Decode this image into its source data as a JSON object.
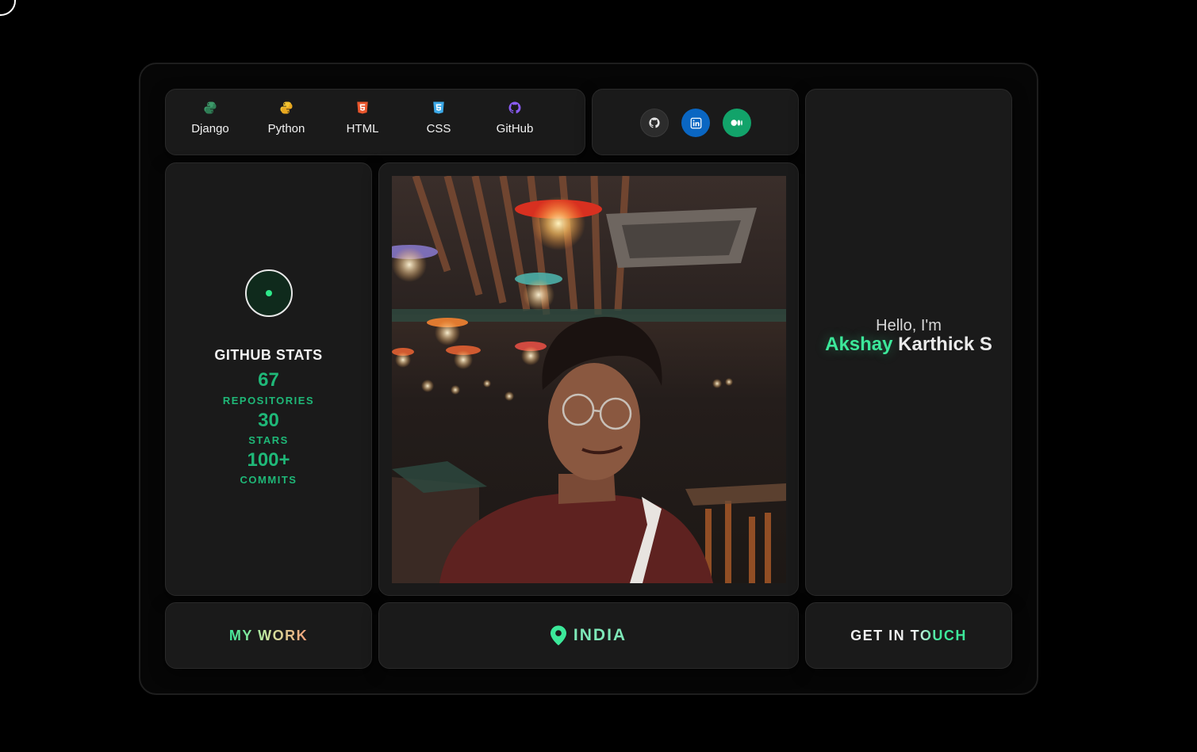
{
  "skills": [
    {
      "label": "Django",
      "icon": "django-icon",
      "color": "#3d9a6a"
    },
    {
      "label": "Python",
      "icon": "python-icon",
      "color": "#f2c230"
    },
    {
      "label": "HTML",
      "icon": "html5-icon",
      "color": "#e8552c"
    },
    {
      "label": "CSS",
      "icon": "css3-icon",
      "color": "#3ca9e8"
    },
    {
      "label": "GitHub",
      "icon": "github-icon",
      "color": "#8b5cf6"
    }
  ],
  "socials": [
    {
      "icon": "github-icon",
      "color": "#2c2c2c"
    },
    {
      "icon": "linkedin-icon",
      "color": "#0a66c2"
    },
    {
      "icon": "medium-icon",
      "color": "#12a36a"
    }
  ],
  "stats": {
    "title": "GITHUB STATS",
    "items": [
      {
        "value": "67",
        "label": "REPOSITORIES"
      },
      {
        "value": "30",
        "label": "STARS"
      },
      {
        "value": "100+",
        "label": "COMMITS"
      }
    ]
  },
  "hero": {
    "greeting": "Hello, I'm",
    "first_name": "Akshay",
    "last_name": "Karthick S"
  },
  "buttons": {
    "work": "MY WORK",
    "location": "INDIA",
    "contact": "GET IN TOUCH"
  },
  "colors": {
    "accent": "#3ce89a",
    "card": "#1a1a1a",
    "background": "#000000"
  }
}
